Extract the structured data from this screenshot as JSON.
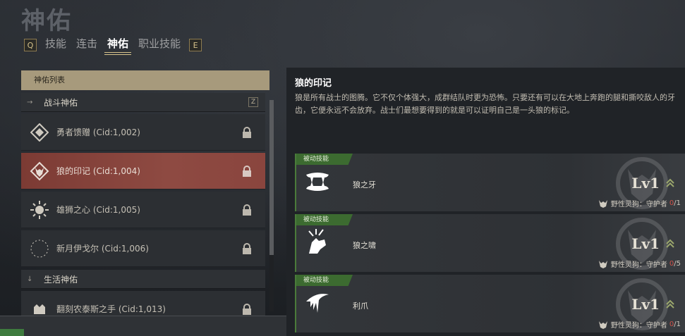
{
  "page_title": "神佑",
  "tabs": {
    "left_key": "Q",
    "right_key": "E",
    "items": [
      {
        "label": "技能",
        "active": false
      },
      {
        "label": "连击",
        "active": false
      },
      {
        "label": "神佑",
        "active": true
      },
      {
        "label": "职业技能",
        "active": false
      }
    ]
  },
  "list": {
    "header": "神佑列表",
    "combat_category": {
      "label": "战斗神佑",
      "arrow": "→",
      "key": "Z"
    },
    "items": [
      {
        "name": "勇者馈赠 (Cid:1,002)",
        "icon": "emblem-icon"
      },
      {
        "name": "狼的印记 (Cid:1,004)",
        "icon": "wolf-icon",
        "selected": true
      },
      {
        "name": "雄狮之心 (Cid:1,005)",
        "icon": "lion-icon"
      },
      {
        "name": "新月伊戈尔 (Cid:1,006)",
        "icon": "crescent-icon"
      }
    ],
    "life_category": {
      "label": "生活神佑",
      "arrow": "↓"
    },
    "partial_item": {
      "name": "翻刻农泰斯之手 (Cid:1,013)"
    }
  },
  "detail": {
    "title": "狼的印记",
    "description": "狼是所有战士的图腾。它不仅个体强大，成群结队时更为恐怖。只要还有可以在大地上奔跑的腿和撕咬敌人的牙齿，它便永远不会放弃。战士们最想要得到的就是可以证明自己是一头狼的标记。",
    "skills": [
      {
        "badge": "被动技能",
        "name": "狼之牙",
        "level": "Lv1",
        "req_label": "野性灵狗：守护者",
        "req_current": "0",
        "req_total": "/1",
        "icon": "fang-icon"
      },
      {
        "badge": "被动技能",
        "name": "狼之啸",
        "level": "Lv1",
        "req_label": "野性灵狗：守护者",
        "req_current": "0",
        "req_total": "/5",
        "icon": "howl-icon"
      },
      {
        "badge": "被动技能",
        "name": "利爪",
        "level": "Lv1",
        "req_label": "野性灵狗：守护者",
        "req_current": "0",
        "req_total": "/1",
        "icon": "claw-icon"
      }
    ]
  },
  "colors": {
    "selected_item": "#8e4a42",
    "passive_badge": "#3c6b30",
    "requirement_current": "#d0534a",
    "gold_accent": "#d8c48c"
  }
}
